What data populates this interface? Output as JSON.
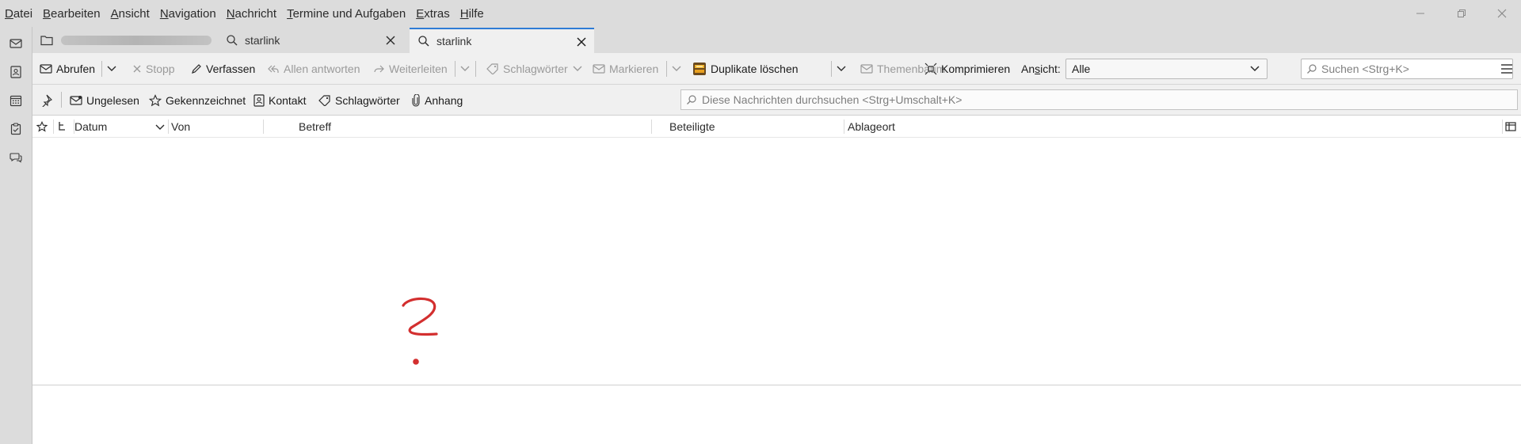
{
  "menubar": {
    "items": [
      {
        "pre": "",
        "u": "D",
        "post": "atei"
      },
      {
        "pre": "",
        "u": "B",
        "post": "earbeiten"
      },
      {
        "pre": "",
        "u": "A",
        "post": "nsicht"
      },
      {
        "pre": "",
        "u": "N",
        "post": "avigation"
      },
      {
        "pre": "",
        "u": "N",
        "post": "achricht"
      },
      {
        "pre": "",
        "u": "T",
        "post": "ermine und Aufgaben"
      },
      {
        "pre": "",
        "u": "E",
        "post": "xtras"
      },
      {
        "pre": "",
        "u": "H",
        "post": "ilfe"
      }
    ]
  },
  "tabs": [
    {
      "title": ""
    },
    {
      "title": "starlink"
    },
    {
      "title": "starlink"
    }
  ],
  "toolbar": {
    "abrufen": "Abrufen",
    "stopp": "Stopp",
    "verfassen": "Verfassen",
    "allen_antworten": "Allen antworten",
    "weiterleiten": "Weiterleiten",
    "schlagwoerter": "Schlagwörter",
    "markieren": "Markieren",
    "duplikate": "Duplikate löschen",
    "themenbaum": "Themenbaum",
    "komprimieren": "Komprimieren",
    "ansicht_label_pre": "An",
    "ansicht_label_u": "s",
    "ansicht_label_post": "icht:",
    "ansicht_value": "Alle",
    "search_placeholder": "Suchen <Strg+K>"
  },
  "filterbar": {
    "ungelesen": "Ungelesen",
    "gekennzeichnet": "Gekennzeichnet",
    "kontakt": "Kontakt",
    "schlagwoerter": "Schlagwörter",
    "anhang": "Anhang",
    "quick_placeholder": "Diese Nachrichten durchsuchen <Strg+Umschalt+K>"
  },
  "columns": {
    "datum": "Datum",
    "von": "Von",
    "betreff": "Betreff",
    "beteiligte": "Beteiligte",
    "ablageort": "Ablageort"
  },
  "colors": {
    "chrome": "#dcdcdc",
    "toolbar": "#f0f0f0",
    "accent": "#2e7bd6",
    "annotation": "#d32f2f"
  },
  "icons": {
    "spaces": [
      "mail-icon",
      "address-book-icon",
      "calendar-icon",
      "tasks-icon",
      "chat-icon"
    ]
  }
}
